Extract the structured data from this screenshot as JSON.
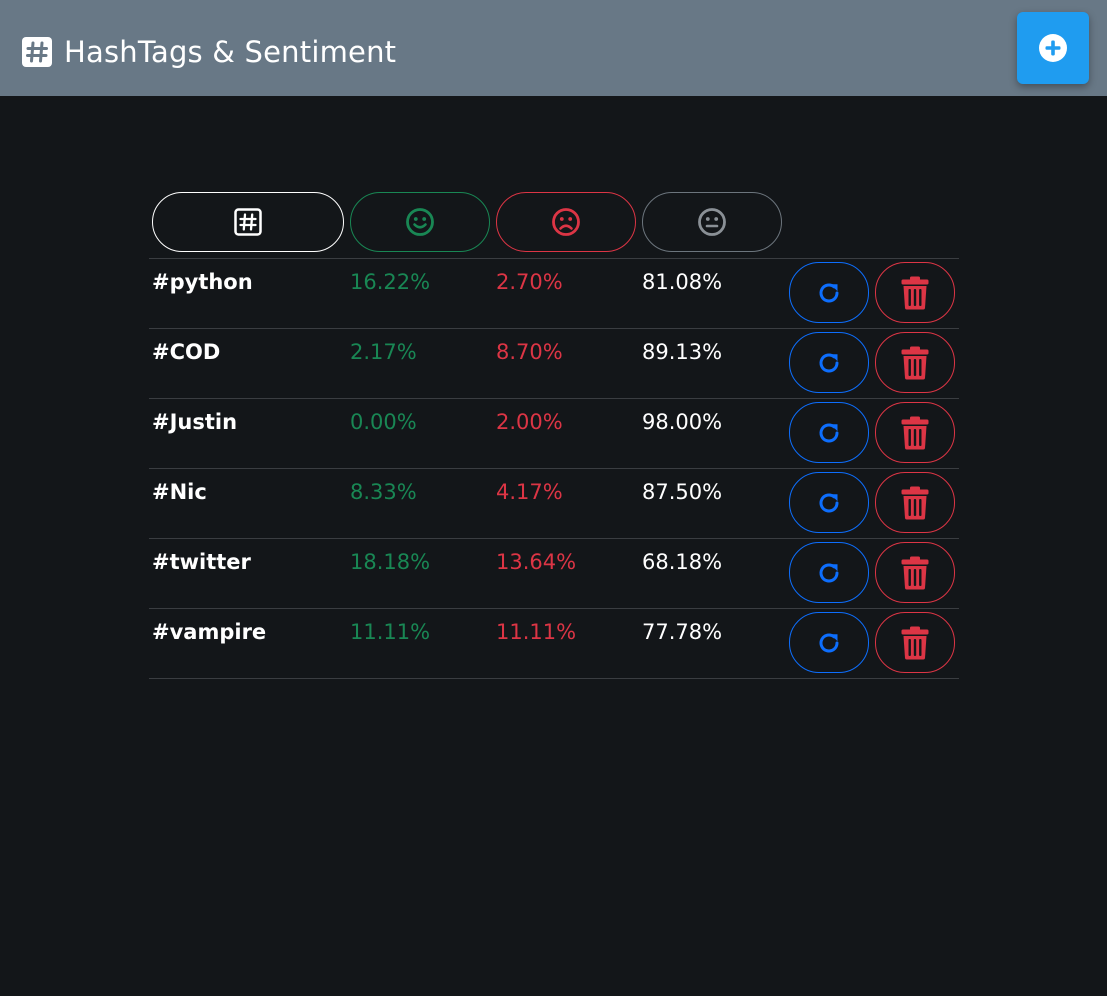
{
  "app": {
    "title": "HashTags & Sentiment"
  },
  "header": {
    "icons": [
      "hash-icon",
      "smile-icon",
      "frown-icon",
      "neutral-face-icon"
    ]
  },
  "rows": [
    {
      "tag": "#python",
      "positive": "16.22%",
      "negative": "2.70%",
      "neutral": "81.08%"
    },
    {
      "tag": "#COD",
      "positive": "2.17%",
      "negative": "8.70%",
      "neutral": "89.13%"
    },
    {
      "tag": "#Justin",
      "positive": "0.00%",
      "negative": "2.00%",
      "neutral": "98.00%"
    },
    {
      "tag": "#Nic",
      "positive": "8.33%",
      "negative": "4.17%",
      "neutral": "87.50%"
    },
    {
      "tag": "#twitter",
      "positive": "18.18%",
      "negative": "13.64%",
      "neutral": "68.18%"
    },
    {
      "tag": "#vampire",
      "positive": "11.11%",
      "negative": "11.11%",
      "neutral": "77.78%"
    }
  ],
  "colors": {
    "navbar": "#687886",
    "background": "#131619",
    "add_button": "#1f9cf0",
    "positive": "#198754",
    "negative": "#dc3545",
    "neutral_border": "#6c757d",
    "refresh": "#0d6efd"
  }
}
